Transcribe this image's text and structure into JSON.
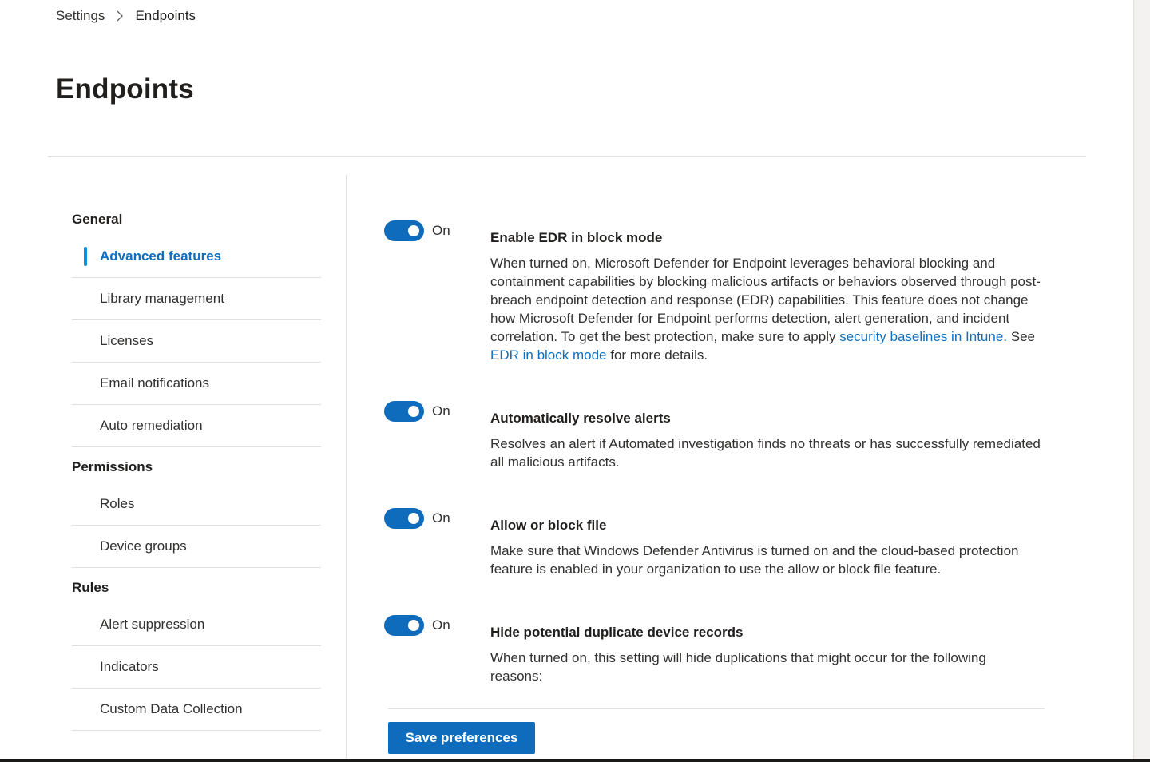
{
  "breadcrumb": {
    "root": "Settings",
    "current": "Endpoints",
    "separator_icon": "chevron-right-icon"
  },
  "page": {
    "title": "Endpoints"
  },
  "nav": {
    "groups": [
      {
        "title": "General",
        "items": [
          {
            "label": "Advanced features",
            "active": true
          },
          {
            "label": "Library management"
          },
          {
            "label": "Licenses"
          },
          {
            "label": "Email notifications"
          },
          {
            "label": "Auto remediation"
          }
        ]
      },
      {
        "title": "Permissions",
        "items": [
          {
            "label": "Roles"
          },
          {
            "label": "Device groups"
          }
        ]
      },
      {
        "title": "Rules",
        "items": [
          {
            "label": "Alert suppression"
          },
          {
            "label": "Indicators"
          },
          {
            "label": "Custom Data Collection"
          }
        ]
      }
    ]
  },
  "settings": [
    {
      "toggle_state": "On",
      "title": "Enable EDR in block mode",
      "desc_before": "When turned on, Microsoft Defender for Endpoint leverages behavioral blocking and containment capabilities by blocking malicious artifacts or behaviors observed through post-breach endpoint detection and response (EDR) capabilities. This feature does not change how Microsoft Defender for Endpoint performs detection, alert generation, and incident correlation. To get the best protection, make sure to apply ",
      "link1": "security baselines in Intune",
      "desc_middle": ". See ",
      "link2": "EDR in block mode",
      "desc_after": " for more details."
    },
    {
      "toggle_state": "On",
      "title": "Automatically resolve alerts",
      "desc": "Resolves an alert if Automated investigation finds no threats or has successfully remediated all malicious artifacts."
    },
    {
      "toggle_state": "On",
      "title": "Allow or block file",
      "desc": "Make sure that Windows Defender Antivirus is turned on and the cloud-based protection feature is enabled in your organization to use the allow or block file feature."
    },
    {
      "toggle_state": "On",
      "title": "Hide potential duplicate device records",
      "desc": "When turned on, this setting will hide duplications that might occur for the following reasons:"
    }
  ],
  "footer": {
    "save_label": "Save preferences"
  },
  "colors": {
    "accent": "#0f6cbd",
    "link": "#106ebe",
    "active_indicator": "#0f8fd6"
  }
}
